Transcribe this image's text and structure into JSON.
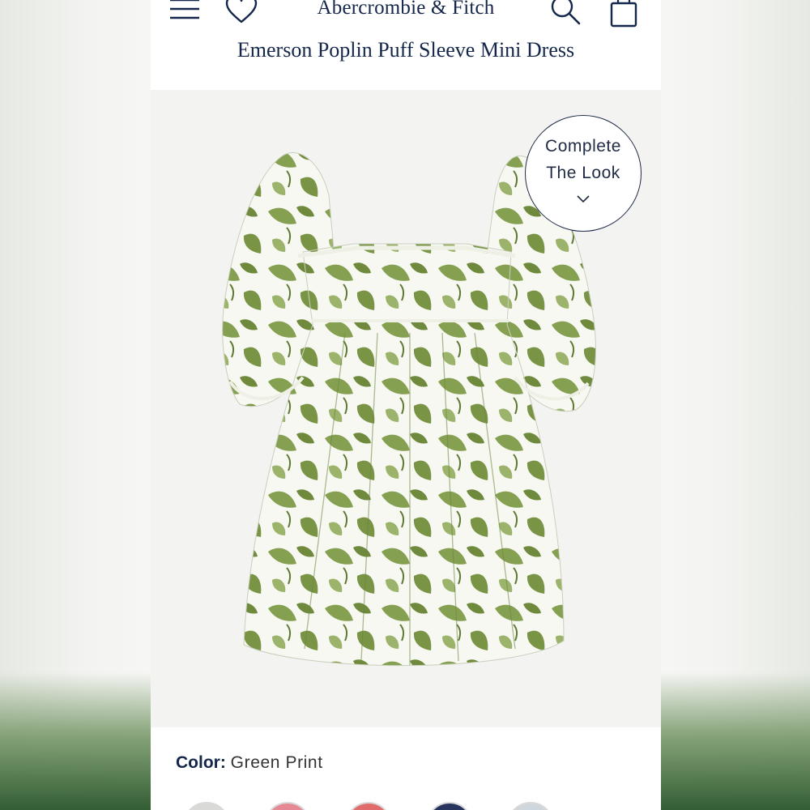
{
  "header": {
    "brand": "Abercrombie & Fitch",
    "icons": [
      "menu-icon",
      "heart-icon",
      "search-icon",
      "bag-icon"
    ]
  },
  "product": {
    "title": "Emerson Poplin Puff Sleeve Mini Dress"
  },
  "complete_look": {
    "line1": "Complete",
    "line2": "The Look",
    "icon": "chevron-down-icon"
  },
  "color": {
    "label": "Color:",
    "value": "Green Print"
  },
  "swatches": [
    {
      "name": "swatch-1",
      "color": "#d9d9d6"
    },
    {
      "name": "swatch-2",
      "color": "#e58a94"
    },
    {
      "name": "swatch-3",
      "color": "#e06c6c"
    },
    {
      "name": "swatch-4",
      "color": "#27355e"
    },
    {
      "name": "swatch-5",
      "color": "#cfd7dc"
    }
  ],
  "colors": {
    "brand_navy": "#14264a",
    "print_green": "#7f9a4a"
  }
}
